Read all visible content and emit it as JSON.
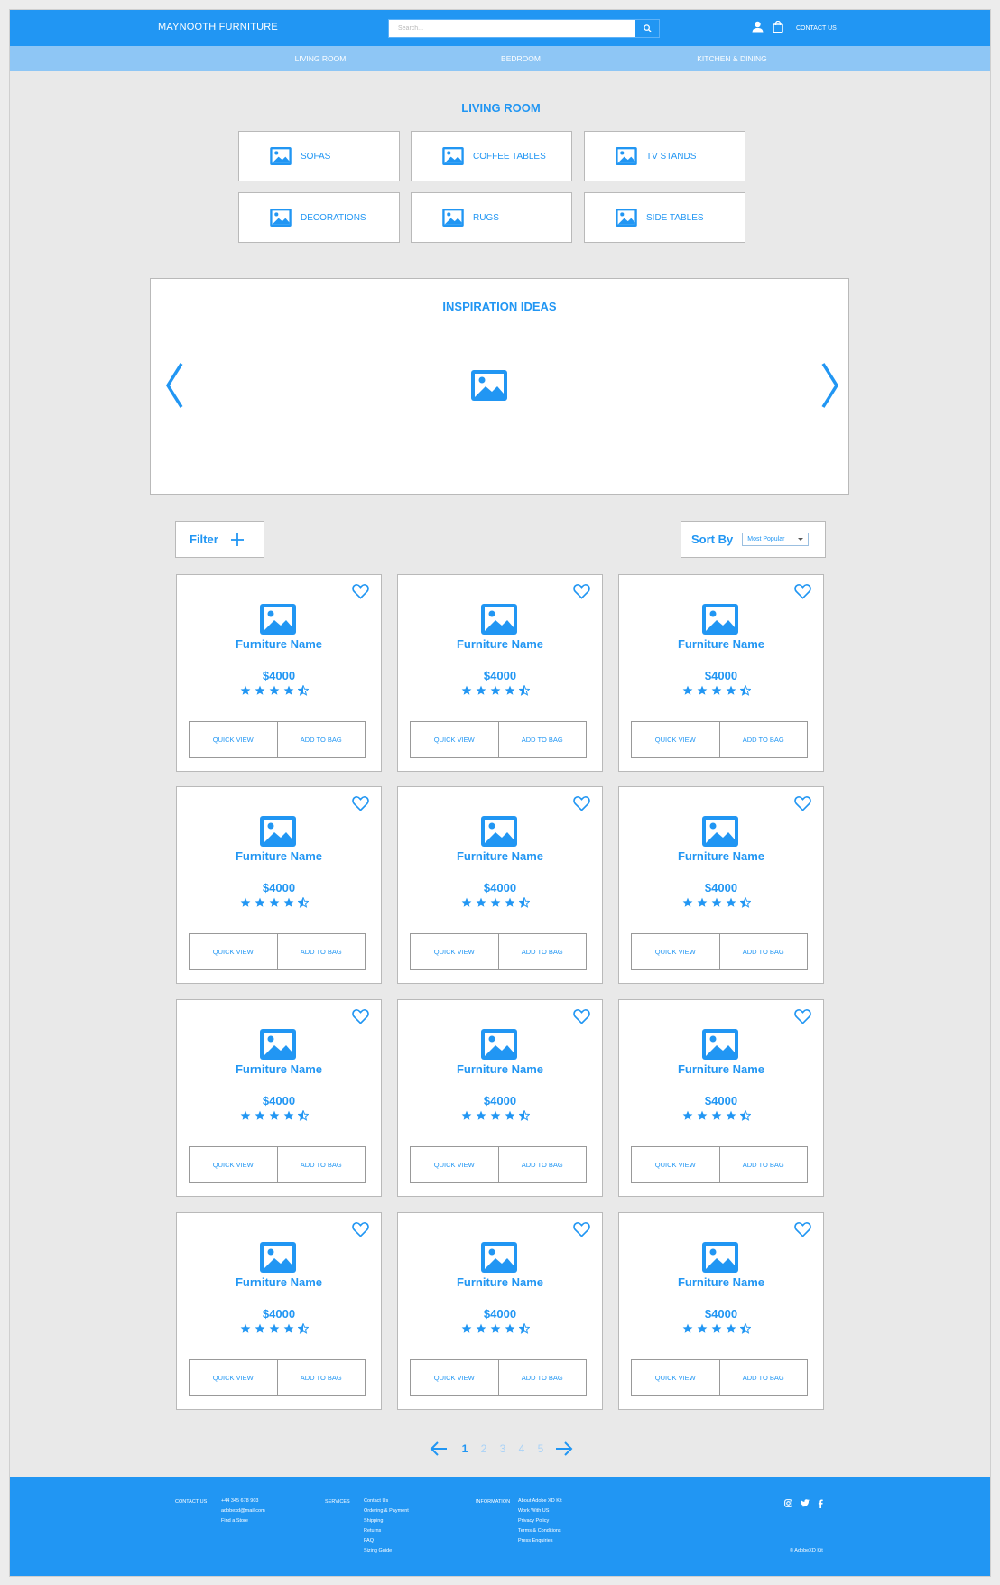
{
  "header": {
    "logo": "MAYNOOTH FURNITURE",
    "search_placeholder": "Search...",
    "contact": "CONTACT US"
  },
  "nav": {
    "items": [
      "LIVING ROOM",
      "BEDROOM",
      "KITCHEN & DINING"
    ]
  },
  "section": {
    "title": "LIVING ROOM"
  },
  "categories": [
    "SOFAS",
    "COFFEE TABLES",
    "TV STANDS",
    "DECORATIONS",
    "RUGS",
    "SIDE TABLES"
  ],
  "inspiration": {
    "title": "INSPIRATION IDEAS"
  },
  "toolbar": {
    "filter_label": "Filter",
    "sort_label": "Sort By",
    "sort_value": "Most Popular"
  },
  "products": {
    "items": [
      {
        "name": "Furniture Name",
        "price": "$4000",
        "rating": 4.5
      },
      {
        "name": "Furniture Name",
        "price": "$4000",
        "rating": 4.5
      },
      {
        "name": "Furniture Name",
        "price": "$4000",
        "rating": 4.5
      },
      {
        "name": "Furniture Name",
        "price": "$4000",
        "rating": 4.5
      },
      {
        "name": "Furniture Name",
        "price": "$4000",
        "rating": 4.5
      },
      {
        "name": "Furniture Name",
        "price": "$4000",
        "rating": 4.5
      },
      {
        "name": "Furniture Name",
        "price": "$4000",
        "rating": 4.5
      },
      {
        "name": "Furniture Name",
        "price": "$4000",
        "rating": 4.5
      },
      {
        "name": "Furniture Name",
        "price": "$4000",
        "rating": 4.5
      },
      {
        "name": "Furniture Name",
        "price": "$4000",
        "rating": 4.5
      },
      {
        "name": "Furniture Name",
        "price": "$4000",
        "rating": 4.5
      },
      {
        "name": "Furniture Name",
        "price": "$4000",
        "rating": 4.5
      }
    ],
    "quick_view_label": "QUICK VIEW",
    "add_to_bag_label": "ADD TO BAG"
  },
  "pagination": {
    "pages": [
      "1",
      "2",
      "3",
      "4",
      "5"
    ],
    "current": "1"
  },
  "footer": {
    "contact_head": "CONTACT US",
    "contact_lines": [
      "+44 345 678 903",
      "adobexd@mail.com",
      "Find a Store"
    ],
    "services_head": "SERVICES",
    "services_lines": [
      "Contact Us",
      "Ordering & Payment",
      "Shipping",
      "Returns",
      "FAQ",
      "Sizing Guide"
    ],
    "info_head": "INFORMATION",
    "info_lines": [
      "About Adobe XD Kit",
      "Work With US",
      "Privacy Policy",
      "Terms & Conditions",
      "Press Enquiries"
    ],
    "social_icons": [
      "instagram-icon",
      "twitter-icon",
      "facebook-icon"
    ],
    "copyright": "© AdobeXD Kit"
  },
  "colors": {
    "accent": "#2196f3",
    "subnav": "#8ec6f5",
    "background": "#e9e9e9"
  }
}
